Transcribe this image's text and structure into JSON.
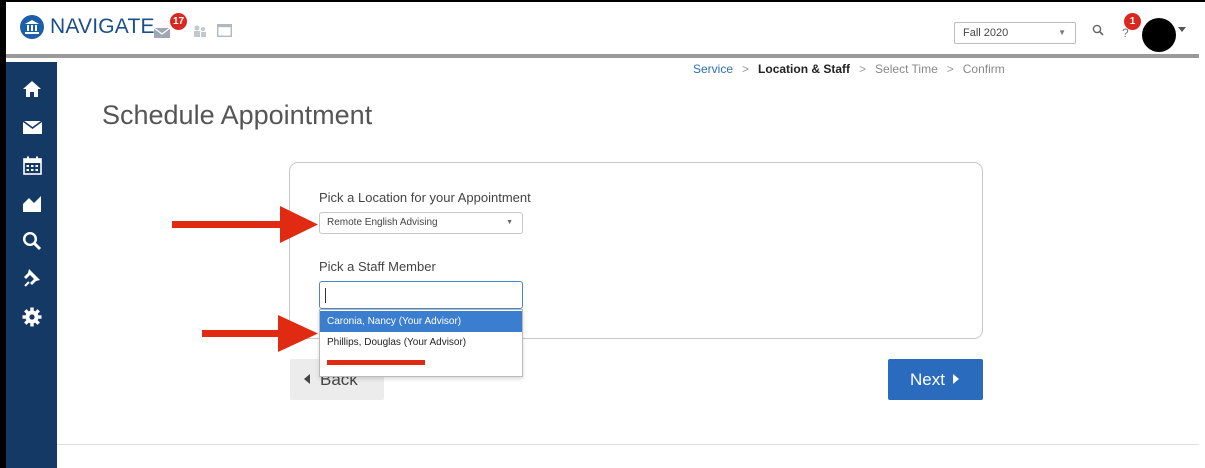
{
  "app": {
    "name": "NAVIGATE"
  },
  "topbar": {
    "messages_badge": "17",
    "term": "Fall 2020",
    "help_badge": "1"
  },
  "breadcrumb": {
    "step1": "Service",
    "step2": "Location & Staff",
    "step3": "Select Time",
    "step4": "Confirm",
    "separator": ">"
  },
  "page": {
    "title": "Schedule Appointment"
  },
  "form": {
    "location_label": "Pick a Location for your Appointment",
    "location_value": "Remote English Advising",
    "staff_label": "Pick a Staff Member",
    "staff_value": "",
    "staff_options": [
      "Caronia, Nancy (Your Advisor)",
      "Phillips, Douglas (Your Advisor)"
    ]
  },
  "buttons": {
    "back": "Back",
    "next": "Next"
  },
  "colors": {
    "brand": "#1c5ea8",
    "sidebar": "#143964",
    "primary_button": "#2a6bbd",
    "selected_option": "#3b7ed0",
    "badge": "#d9281e",
    "annotation_red": "#e02a12"
  },
  "icons": {
    "sidebar": [
      "home-icon",
      "mail-icon",
      "calendar-icon",
      "chart-icon",
      "search-icon",
      "pin-icon",
      "gear-icon"
    ]
  }
}
